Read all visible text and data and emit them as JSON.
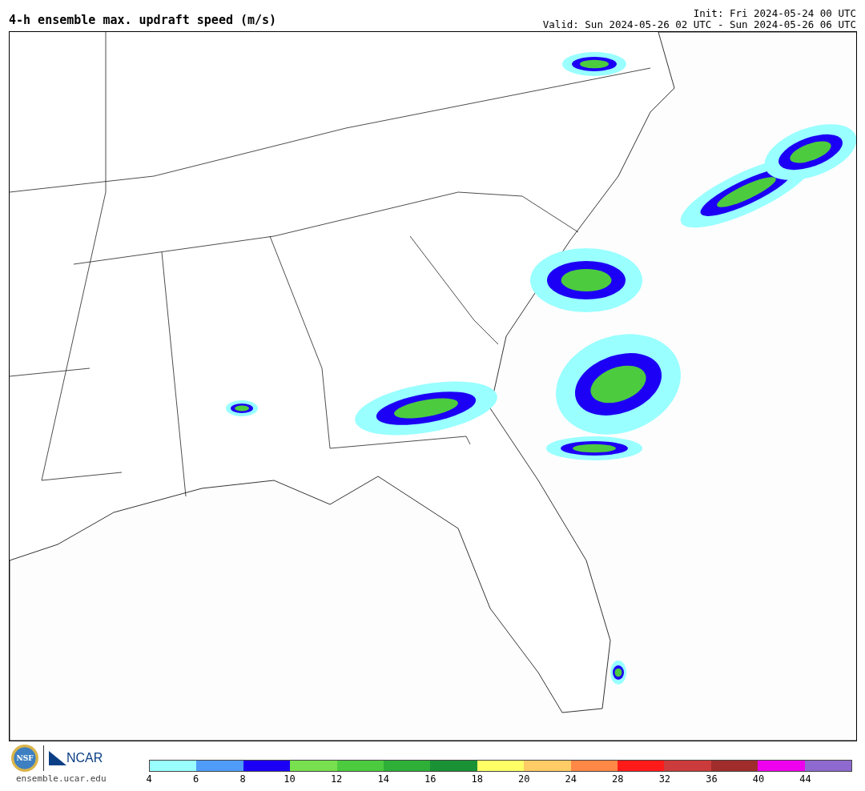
{
  "title": "4-h ensemble max. updraft speed (m/s)",
  "init": "Init: Fri 2024-05-24 00 UTC",
  "valid": "Valid: Sun 2024-05-26 02 UTC - Sun 2024-05-26 06 UTC",
  "logos": {
    "nsf": "NSF",
    "ncar": "NCAR",
    "url": "ensemble.ucar.edu"
  },
  "colorbar": {
    "segments": [
      {
        "color": "#99ffff"
      },
      {
        "color": "#4f9df8"
      },
      {
        "color": "#1c00f5"
      },
      {
        "color": "#78e04e"
      },
      {
        "color": "#4ccb3f"
      },
      {
        "color": "#2eaf38"
      },
      {
        "color": "#1b9136"
      },
      {
        "color": "#ffff66"
      },
      {
        "color": "#ffcc66"
      },
      {
        "color": "#ff8846"
      },
      {
        "color": "#ff1a1a"
      },
      {
        "color": "#cc3b3b"
      },
      {
        "color": "#a02c2c"
      },
      {
        "color": "#ee00ee"
      },
      {
        "color": "#8e69cf"
      }
    ],
    "ticks": [
      "4",
      "6",
      "8",
      "10",
      "12",
      "14",
      "16",
      "18",
      "20",
      "24",
      "28",
      "32",
      "36",
      "40",
      "44"
    ]
  }
}
